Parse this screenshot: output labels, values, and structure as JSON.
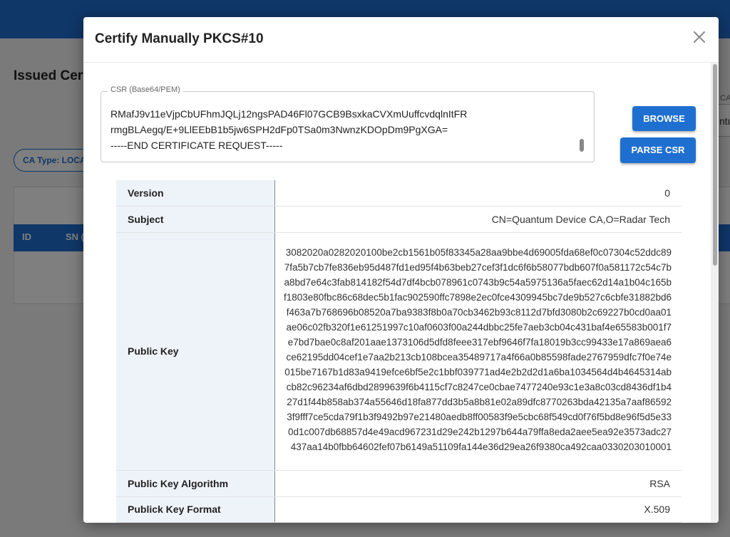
{
  "background": {
    "page_title": "Issued Cert",
    "filter_chip": "CA Type: LOCA",
    "table_headers": [
      "ID",
      "SN ("
    ],
    "right_label": "CA",
    "right_field_value": "ntu"
  },
  "modal": {
    "title": "Certify Manually PKCS#10",
    "close_glyph": "×",
    "csr": {
      "label": "CSR (Base64/PEM)",
      "lines": [
        "RMafJ9v11eVjpCbUFhmJQLj12ngsPAD46Fl07GCB9BsxkaCVXmUuffcvdqlnItFR",
        "rmgBLAegq/E+9LlEEbB1b5jw6SPH2dFp0TSa0m3NwnzKDOpDm9PgXGA=",
        "-----END CERTIFICATE REQUEST-----"
      ]
    },
    "buttons": {
      "browse": "BROWSE",
      "parse": "PARSE CSR"
    },
    "details": [
      {
        "key": "Version",
        "value": "0"
      },
      {
        "key": "Subject",
        "value": "CN=Quantum Device CA,O=Radar Tech"
      },
      {
        "key": "Public Key",
        "value": "3082020a0282020100be2cb1561b05f83345a28aa9bbe4d69005fda68ef0c07304c52ddc897fa5b7cb7fe836eb95d487fd1ed95f4b63beb27cef3f1dc6f6b58077bdb607f0a581172c54c7ba8bd7e64c3fab814182f54d7df4bcb078961c0743b9c54a5975136a5faec62d14a1b04c165bf1803e80fbc86c68dec5b1fac902590ffc7898e2ec0fce4309945bc7de9b527c6cbfe31882bd6f463a7b768696b08520a7ba9383f8b0a70cb3462b93c8112d7bfd3080b2c69227b0cd0aa01ae06c02fb320f1e61251997c10af0603f00a244dbbc25fe7aeb3cb04c431baf4e65583b001f7e7bd7bae0c8af201aae1373106d5dfd8feee317ebf9646f7fa18019b3cc99433e17a869aea6ce62195dd04cef1e7aa2b213cb108bcea35489717a4f66a0b85598fade2767959dfc7f0e74e015be7167b1d83a9419efce6bf5e2c1bbf039771ad4e2b2d2d1a6ba1034564d4b4645314abcb82c96234af6dbd2899639f6b4115cf7c8247ce0cbae7477240e93c1e3a8c03cd8436df1b427d1f44b858ab374a55646d18fa877dd3b5a8b81e02a89dfc8770263bda42135a7aaf865923f9fff7ce5cda79f1b3f9492b97e21480aedb8ff00583f9e5cbc68f549cd0f76f5bd8e96f5d5e330d1c007db68857d4e49acd967231d29e242b1297b644a79ffa8eda2aee5ea92e3573adc27437aa14b0fbb64602fef07b6149a51109fa144e36d29ea26f9380ca492caa0330203010001"
      },
      {
        "key": "Public Key Algorithm",
        "value": "RSA"
      },
      {
        "key": "Publick Key Format",
        "value": "X.509"
      }
    ]
  }
}
